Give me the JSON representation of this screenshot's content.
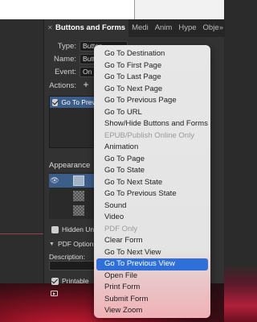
{
  "panel": {
    "tabs": [
      {
        "label": "Buttons and Forms",
        "active": true
      },
      {
        "label": "Medi"
      },
      {
        "label": "Anim"
      },
      {
        "label": "Hype"
      },
      {
        "label": "Obje"
      }
    ],
    "overflow_icon": "double-chevron-right-icon",
    "close_icon": "close-icon",
    "type": {
      "label": "Type:",
      "value": "Button"
    },
    "name": {
      "label": "Name:",
      "value": "Butt"
    },
    "event": {
      "label": "Event:",
      "value": "On R"
    },
    "actions": {
      "label": "Actions:",
      "add_symbol": "+",
      "remove_symbol": "-"
    },
    "action_items": [
      {
        "label": "Go To Previous",
        "checked": true
      }
    ],
    "appearance": {
      "label": "Appearance"
    },
    "hidden_until": {
      "label": "Hidden Until T",
      "checked": false
    },
    "pdf_options": {
      "label": "PDF Options"
    },
    "description": {
      "label": "Description:",
      "value": ""
    },
    "printable": {
      "label": "Printable",
      "checked": true
    },
    "preview_icon": "preview-icon"
  },
  "menu": {
    "items": [
      {
        "label": "Go To Destination",
        "type": "item"
      },
      {
        "label": "Go To First Page",
        "type": "item"
      },
      {
        "label": "Go To Last Page",
        "type": "item"
      },
      {
        "label": "Go To Next Page",
        "type": "item"
      },
      {
        "label": "Go To Previous Page",
        "type": "item"
      },
      {
        "label": "Go To URL",
        "type": "item"
      },
      {
        "label": "Show/Hide Buttons and Forms",
        "type": "item"
      },
      {
        "label": "EPUB/Publish Online Only",
        "type": "header"
      },
      {
        "label": "Animation",
        "type": "item"
      },
      {
        "label": "Go To Page",
        "type": "item"
      },
      {
        "label": "Go To State",
        "type": "item"
      },
      {
        "label": "Go To Next State",
        "type": "item"
      },
      {
        "label": "Go To Previous State",
        "type": "item"
      },
      {
        "label": "Sound",
        "type": "item"
      },
      {
        "label": "Video",
        "type": "item"
      },
      {
        "label": "PDF Only",
        "type": "header"
      },
      {
        "label": "Clear Form",
        "type": "item"
      },
      {
        "label": "Go To Next View",
        "type": "item"
      },
      {
        "label": "Go To Previous View",
        "type": "item",
        "highlighted": true
      },
      {
        "label": "Open File",
        "type": "item"
      },
      {
        "label": "Print Form",
        "type": "item"
      },
      {
        "label": "Submit Form",
        "type": "item"
      },
      {
        "label": "View Zoom",
        "type": "item"
      }
    ]
  },
  "colors": {
    "highlight": "#2f6fd8",
    "panel_bg": "#323232",
    "selection": "#3e5e8a",
    "guide": "#e04a6a"
  }
}
